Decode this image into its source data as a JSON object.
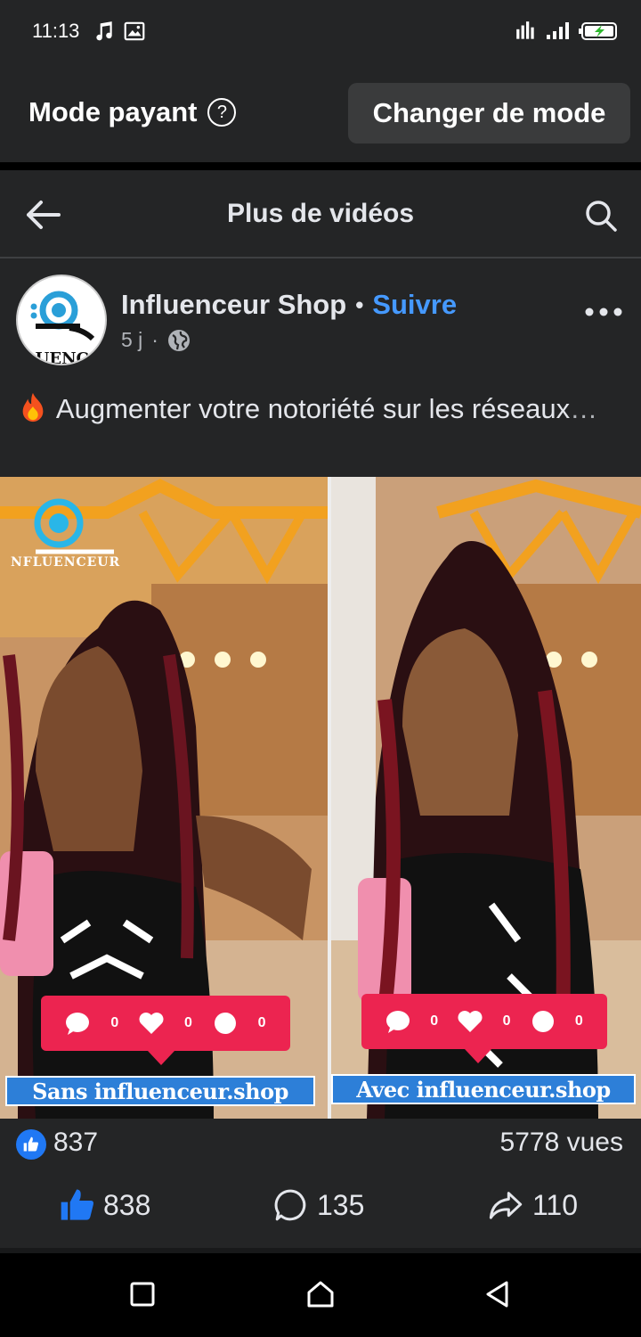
{
  "status_bar": {
    "time": "11:13"
  },
  "mode_bar": {
    "title": "Mode payant",
    "button": "Changer de mode"
  },
  "nav": {
    "title": "Plus de vidéos"
  },
  "post": {
    "author": "Influenceur Shop",
    "follow": "Suivre",
    "time": "5 j",
    "text": "Augmenter votre notoriété sur les réseaux",
    "ellipsis": "…",
    "avatar_text": "LUENC"
  },
  "video": {
    "logo_text": "NFLUENCEUR",
    "left_caption": "Sans influenceur.shop",
    "right_caption": "Avec influenceur.shop",
    "left_counts": [
      "0",
      "0",
      "0"
    ],
    "right_counts": [
      "0",
      "0",
      "0"
    ]
  },
  "stats": {
    "likes": "837",
    "views": "5778 vues"
  },
  "actions": {
    "likes": "838",
    "comments": "135",
    "shares": "110"
  },
  "colors": {
    "background": "#242526",
    "accent": "#4599ff",
    "like_blue": "#2078f4",
    "reaction_card": "#ec2450"
  }
}
